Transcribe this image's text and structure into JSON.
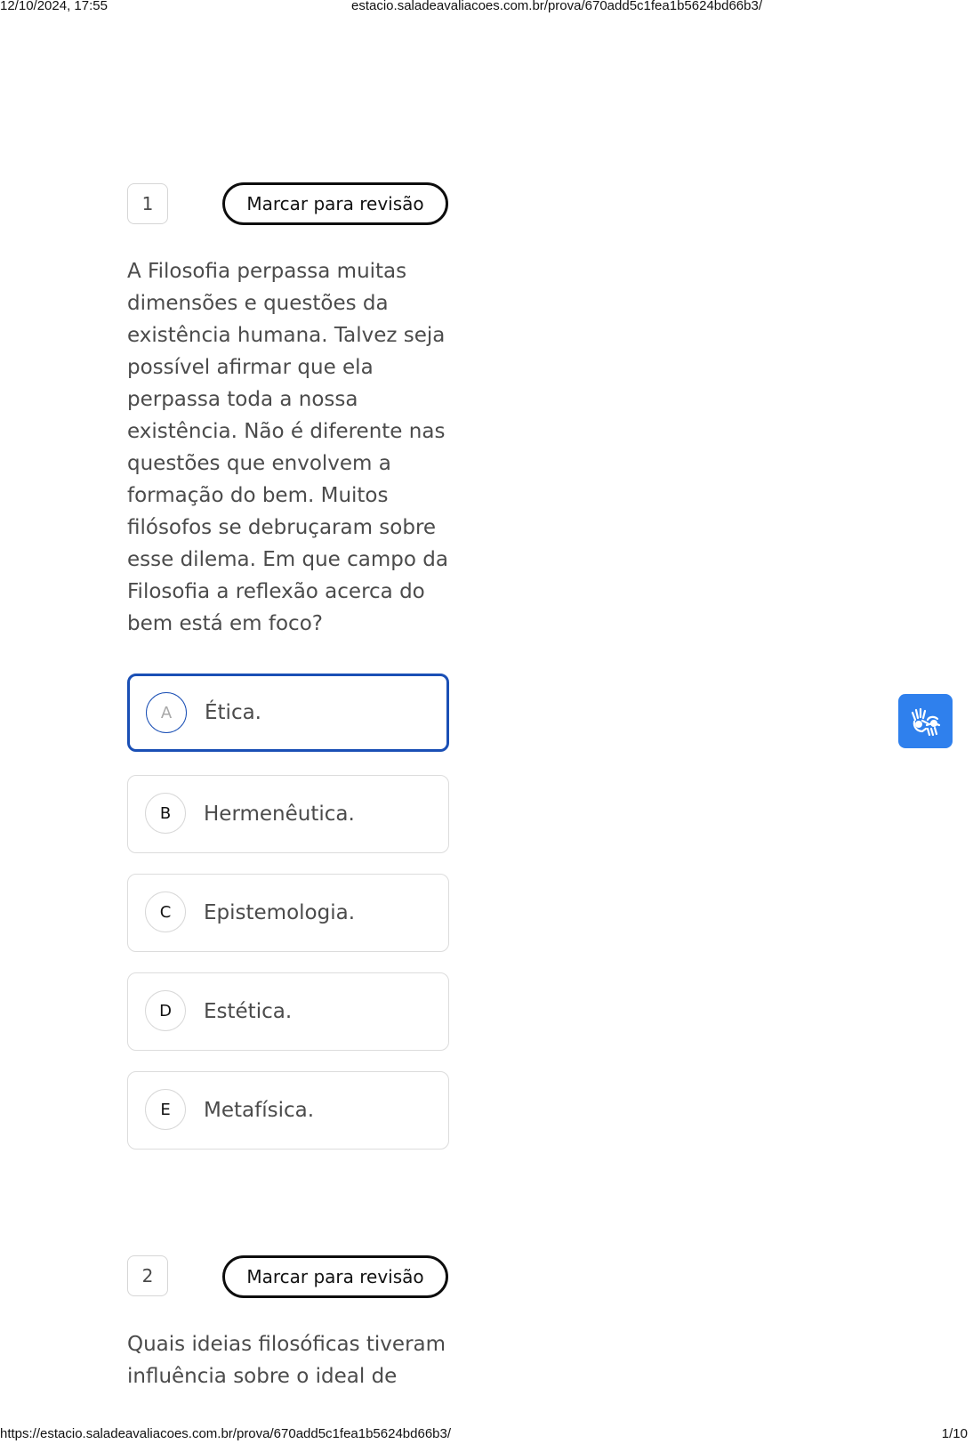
{
  "print_header": {
    "datetime": "12/10/2024, 17:55",
    "url": "estacio.saladeavaliacoes.com.br/prova/670add5c1fea1b5624bd66b3/"
  },
  "print_footer": {
    "url": "https://estacio.saladeavaliacoes.com.br/prova/670add5c1fea1b5624bd66b3/",
    "page": "1/10"
  },
  "questions": [
    {
      "number": "1",
      "review_label": "Marcar para revisão",
      "text": "A Filosofia perpassa muitas dimensões e questões da existência humana. Talvez seja possível afirmar que ela perpassa toda a nossa existência. Não é diferente nas questões que envolvem a formação do bem. Muitos filósofos se debruçaram sobre esse dilema. Em que campo da Filosofia a reflexão acerca do bem está em foco?",
      "options": [
        {
          "letter": "A",
          "text": "Ética.",
          "selected": true
        },
        {
          "letter": "B",
          "text": "Hermenêutica.",
          "selected": false
        },
        {
          "letter": "C",
          "text": "Epistemologia.",
          "selected": false
        },
        {
          "letter": "D",
          "text": "Estética.",
          "selected": false
        },
        {
          "letter": "E",
          "text": "Metafísica.",
          "selected": false
        }
      ]
    },
    {
      "number": "2",
      "review_label": "Marcar para revisão",
      "text": "Quais ideias filosóficas tiveram influência sobre o ideal de"
    }
  ],
  "accessibility": {
    "libras_icon": "sign-language-hands-icon",
    "button_color": "#2f80ed"
  },
  "colors": {
    "selected_border": "#1a4fb5",
    "text": "#4b4b4b"
  }
}
